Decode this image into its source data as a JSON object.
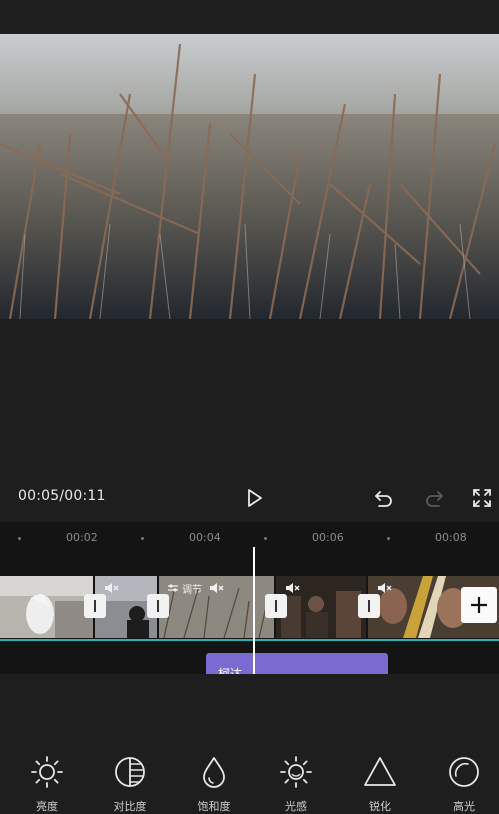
{
  "player": {
    "time_current": "00:05",
    "time_separator": "/",
    "time_total": "00:11"
  },
  "timeline": {
    "ticks": [
      "00:02",
      "00:04",
      "00:06",
      "00:08"
    ],
    "adjust_tag": "调节",
    "filter_label": "柯达"
  },
  "toolbar": {
    "items": [
      {
        "label": "亮度",
        "icon": "brightness-icon"
      },
      {
        "label": "对比度",
        "icon": "contrast-icon"
      },
      {
        "label": "饱和度",
        "icon": "saturation-icon"
      },
      {
        "label": "光感",
        "icon": "exposure-icon"
      },
      {
        "label": "锐化",
        "icon": "sharpen-icon"
      },
      {
        "label": "高光",
        "icon": "highlight-icon"
      }
    ]
  },
  "colors": {
    "background": "#1e1e1e",
    "timeline_bg": "#141414",
    "filter_clip": "#7b6bd0",
    "track_line": "#2bb3b1"
  }
}
